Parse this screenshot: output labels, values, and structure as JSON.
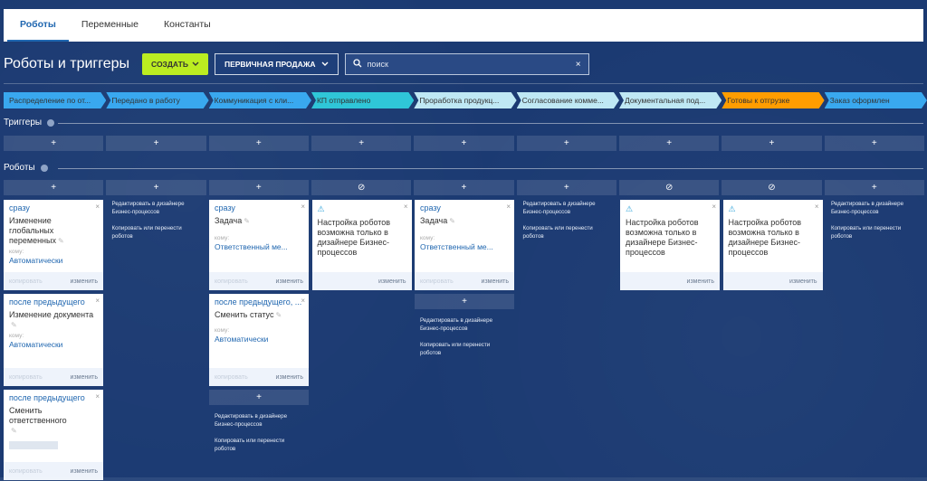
{
  "tabs": [
    {
      "label": "Роботы",
      "active": true
    },
    {
      "label": "Переменные",
      "active": false
    },
    {
      "label": "Константы",
      "active": false
    }
  ],
  "toolbar": {
    "title": "Роботы и триггеры",
    "create_label": "СОЗДАТЬ",
    "funnel_label": "ПЕРВИЧНАЯ ПРОДАЖА",
    "search_placeholder": "поиск"
  },
  "stages": [
    {
      "label": "Распределение по от...",
      "color": "#39a8ef"
    },
    {
      "label": "Передано в работу",
      "color": "#39a8ef"
    },
    {
      "label": "Коммуникация с кли...",
      "color": "#39a8ef"
    },
    {
      "label": "КП отправлено",
      "color": "#2fc6d8"
    },
    {
      "label": "Проработка продукц...",
      "color": "#bfe8f4"
    },
    {
      "label": "Согласование комме...",
      "color": "#bfe8f4"
    },
    {
      "label": "Документальная под...",
      "color": "#bfe8f4"
    },
    {
      "label": "Готовы к отгрузке",
      "color": "#ff9d00"
    },
    {
      "label": "Заказ оформлен",
      "color": "#39a8ef"
    }
  ],
  "sections": {
    "triggers": "Триггеры",
    "robots": "Роботы"
  },
  "icons": {
    "add": "+",
    "blocked": "⊘",
    "close": "×",
    "pen": "✎",
    "warning": "⚠"
  },
  "labels": {
    "komu": "кому:",
    "copy": "копировать",
    "edit": "изменить",
    "bp_edit": "Редактировать в дизайнере Бизнес-процессов",
    "bp_copy": "Копировать или перенести роботов"
  },
  "robot_row_icons": [
    "+",
    "+",
    "+",
    "⊘",
    "+",
    "+",
    "⊘",
    "⊘",
    "+"
  ],
  "columns": {
    "c1": {
      "cards": [
        {
          "cond": "сразу",
          "name": "Изменение глобальных переменных",
          "komu": "Автоматически"
        },
        {
          "cond": "после предыдущего",
          "name": "Изменение документа",
          "komu": "Автоматически"
        },
        {
          "cond": "после предыдущего",
          "name": "Сменить ответственного",
          "komu": ""
        }
      ]
    },
    "c3": {
      "cards": [
        {
          "cond": "сразу",
          "name": "Задача",
          "komu": "Ответственный ме..."
        },
        {
          "cond": "после предыдущего, ...",
          "name": "Сменить статус",
          "komu": "Автоматически"
        }
      ]
    },
    "c4": {
      "warning": "Настройка роботов возможна только в дизайнере Бизнес-процессов"
    },
    "c5": {
      "cards": [
        {
          "cond": "сразу",
          "name": "Задача",
          "komu": "Ответственный ме..."
        }
      ]
    },
    "c7": {
      "warning": "Настройка роботов возможна только в дизайнере Бизнес-процессов"
    },
    "c8": {
      "warning": "Настройка роботов возможна только в дизайнере Бизнес-процессов"
    }
  }
}
